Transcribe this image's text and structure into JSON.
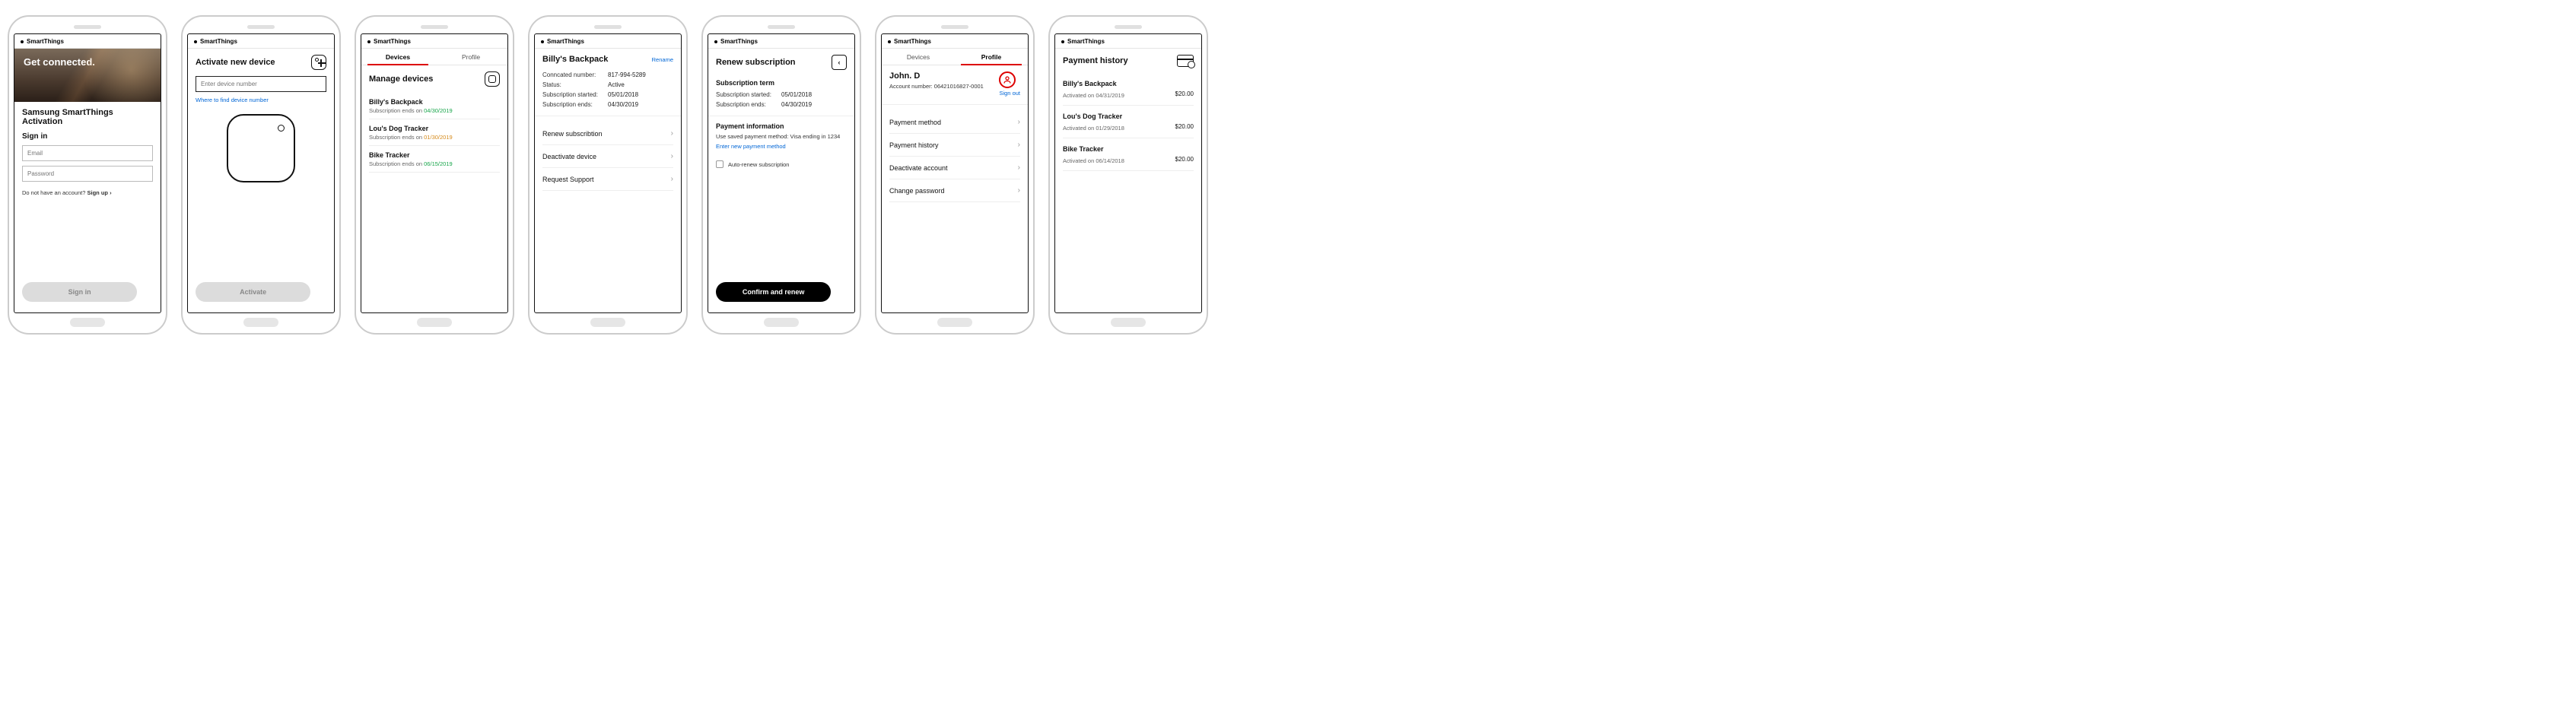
{
  "brand": "SmartThings",
  "screen1": {
    "hero_title": "Get connected.",
    "page_title": "Samsung SmartThings Activation",
    "signin_heading": "Sign in",
    "email_placeholder": "Email",
    "password_placeholder": "Password",
    "no_account_text": "Do not have an account?  ",
    "signup_link": "Sign up  ›",
    "signin_btn": "Sign in"
  },
  "screen2": {
    "title": "Activate new device",
    "input_placeholder": "Enter device number",
    "help_link": "Where to find device number",
    "activate_btn": "Activate"
  },
  "screen3": {
    "tabs": {
      "devices": "Devices",
      "profile": "Profile"
    },
    "title": "Manage devices",
    "items": [
      {
        "name": "Billy's Backpack",
        "sub_prefix": "Subscription ends on  ",
        "date": "04/30/2019",
        "cls": "green"
      },
      {
        "name": "Lou's Dog Tracker",
        "sub_prefix": "Subscription ends on  ",
        "date": "01/30/2019",
        "cls": "orange"
      },
      {
        "name": "Bike Tracker",
        "sub_prefix": "Subscription ends on  ",
        "date": "06/15/2019",
        "cls": "green"
      }
    ]
  },
  "screen4": {
    "title": "Billy's Backpack",
    "rename": "Rename",
    "kv": [
      {
        "k": "Conncated number:",
        "v": "817-994-5289"
      },
      {
        "k": "Status:",
        "v": "Active"
      },
      {
        "k": "Subscription started:",
        "v": "05/01/2018"
      },
      {
        "k": "Subscription ends:",
        "v": "04/30/2019"
      }
    ],
    "rows": [
      "Renew subscribtion",
      "Deactivate device",
      "Request Support"
    ]
  },
  "screen5": {
    "title": "Renew subscription",
    "term_heading": "Subscription term",
    "term": [
      {
        "k": "Subscription started:",
        "v": "05/01/2018"
      },
      {
        "k": "Subscription ends:",
        "v": "04/30/2019"
      }
    ],
    "pay_heading": "Payment information",
    "pay_note": "Use saved payment method: Visa ending in 1234",
    "new_pay_link": "Enter new payment method",
    "auto_label": "Auto-renew subscription",
    "confirm_btn": "Confirm and renew"
  },
  "screen6": {
    "tabs": {
      "devices": "Devices",
      "profile": "Profile"
    },
    "name": "John. D",
    "acct_label": "Account number:  ",
    "acct_num": "06421016827-0001",
    "signout": "Sign out",
    "rows": [
      "Payment method",
      "Payment history",
      "Deactivate account",
      "Change password"
    ]
  },
  "screen7": {
    "title": "Payment history",
    "items": [
      {
        "name": "Billy's Backpack",
        "sub": "Activated on 04/31/2019",
        "amt": "$20.00"
      },
      {
        "name": "Lou's Dog Tracker",
        "sub": "Activated on 01/29/2018",
        "amt": "$20.00"
      },
      {
        "name": "Bike Tracker",
        "sub": "Activated on 06/14/2018",
        "amt": "$20.00"
      }
    ]
  }
}
